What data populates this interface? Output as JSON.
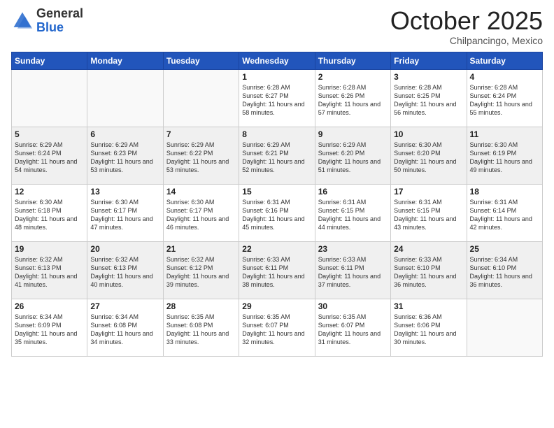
{
  "logo": {
    "general": "General",
    "blue": "Blue"
  },
  "header": {
    "month": "October 2025",
    "location": "Chilpancingo, Mexico"
  },
  "weekdays": [
    "Sunday",
    "Monday",
    "Tuesday",
    "Wednesday",
    "Thursday",
    "Friday",
    "Saturday"
  ],
  "weeks": [
    [
      {
        "day": "",
        "sunrise": "",
        "sunset": "",
        "daylight": ""
      },
      {
        "day": "",
        "sunrise": "",
        "sunset": "",
        "daylight": ""
      },
      {
        "day": "",
        "sunrise": "",
        "sunset": "",
        "daylight": ""
      },
      {
        "day": "1",
        "sunrise": "Sunrise: 6:28 AM",
        "sunset": "Sunset: 6:27 PM",
        "daylight": "Daylight: 11 hours and 58 minutes."
      },
      {
        "day": "2",
        "sunrise": "Sunrise: 6:28 AM",
        "sunset": "Sunset: 6:26 PM",
        "daylight": "Daylight: 11 hours and 57 minutes."
      },
      {
        "day": "3",
        "sunrise": "Sunrise: 6:28 AM",
        "sunset": "Sunset: 6:25 PM",
        "daylight": "Daylight: 11 hours and 56 minutes."
      },
      {
        "day": "4",
        "sunrise": "Sunrise: 6:28 AM",
        "sunset": "Sunset: 6:24 PM",
        "daylight": "Daylight: 11 hours and 55 minutes."
      }
    ],
    [
      {
        "day": "5",
        "sunrise": "Sunrise: 6:29 AM",
        "sunset": "Sunset: 6:24 PM",
        "daylight": "Daylight: 11 hours and 54 minutes."
      },
      {
        "day": "6",
        "sunrise": "Sunrise: 6:29 AM",
        "sunset": "Sunset: 6:23 PM",
        "daylight": "Daylight: 11 hours and 53 minutes."
      },
      {
        "day": "7",
        "sunrise": "Sunrise: 6:29 AM",
        "sunset": "Sunset: 6:22 PM",
        "daylight": "Daylight: 11 hours and 53 minutes."
      },
      {
        "day": "8",
        "sunrise": "Sunrise: 6:29 AM",
        "sunset": "Sunset: 6:21 PM",
        "daylight": "Daylight: 11 hours and 52 minutes."
      },
      {
        "day": "9",
        "sunrise": "Sunrise: 6:29 AM",
        "sunset": "Sunset: 6:20 PM",
        "daylight": "Daylight: 11 hours and 51 minutes."
      },
      {
        "day": "10",
        "sunrise": "Sunrise: 6:30 AM",
        "sunset": "Sunset: 6:20 PM",
        "daylight": "Daylight: 11 hours and 50 minutes."
      },
      {
        "day": "11",
        "sunrise": "Sunrise: 6:30 AM",
        "sunset": "Sunset: 6:19 PM",
        "daylight": "Daylight: 11 hours and 49 minutes."
      }
    ],
    [
      {
        "day": "12",
        "sunrise": "Sunrise: 6:30 AM",
        "sunset": "Sunset: 6:18 PM",
        "daylight": "Daylight: 11 hours and 48 minutes."
      },
      {
        "day": "13",
        "sunrise": "Sunrise: 6:30 AM",
        "sunset": "Sunset: 6:17 PM",
        "daylight": "Daylight: 11 hours and 47 minutes."
      },
      {
        "day": "14",
        "sunrise": "Sunrise: 6:30 AM",
        "sunset": "Sunset: 6:17 PM",
        "daylight": "Daylight: 11 hours and 46 minutes."
      },
      {
        "day": "15",
        "sunrise": "Sunrise: 6:31 AM",
        "sunset": "Sunset: 6:16 PM",
        "daylight": "Daylight: 11 hours and 45 minutes."
      },
      {
        "day": "16",
        "sunrise": "Sunrise: 6:31 AM",
        "sunset": "Sunset: 6:15 PM",
        "daylight": "Daylight: 11 hours and 44 minutes."
      },
      {
        "day": "17",
        "sunrise": "Sunrise: 6:31 AM",
        "sunset": "Sunset: 6:15 PM",
        "daylight": "Daylight: 11 hours and 43 minutes."
      },
      {
        "day": "18",
        "sunrise": "Sunrise: 6:31 AM",
        "sunset": "Sunset: 6:14 PM",
        "daylight": "Daylight: 11 hours and 42 minutes."
      }
    ],
    [
      {
        "day": "19",
        "sunrise": "Sunrise: 6:32 AM",
        "sunset": "Sunset: 6:13 PM",
        "daylight": "Daylight: 11 hours and 41 minutes."
      },
      {
        "day": "20",
        "sunrise": "Sunrise: 6:32 AM",
        "sunset": "Sunset: 6:13 PM",
        "daylight": "Daylight: 11 hours and 40 minutes."
      },
      {
        "day": "21",
        "sunrise": "Sunrise: 6:32 AM",
        "sunset": "Sunset: 6:12 PM",
        "daylight": "Daylight: 11 hours and 39 minutes."
      },
      {
        "day": "22",
        "sunrise": "Sunrise: 6:33 AM",
        "sunset": "Sunset: 6:11 PM",
        "daylight": "Daylight: 11 hours and 38 minutes."
      },
      {
        "day": "23",
        "sunrise": "Sunrise: 6:33 AM",
        "sunset": "Sunset: 6:11 PM",
        "daylight": "Daylight: 11 hours and 37 minutes."
      },
      {
        "day": "24",
        "sunrise": "Sunrise: 6:33 AM",
        "sunset": "Sunset: 6:10 PM",
        "daylight": "Daylight: 11 hours and 36 minutes."
      },
      {
        "day": "25",
        "sunrise": "Sunrise: 6:34 AM",
        "sunset": "Sunset: 6:10 PM",
        "daylight": "Daylight: 11 hours and 36 minutes."
      }
    ],
    [
      {
        "day": "26",
        "sunrise": "Sunrise: 6:34 AM",
        "sunset": "Sunset: 6:09 PM",
        "daylight": "Daylight: 11 hours and 35 minutes."
      },
      {
        "day": "27",
        "sunrise": "Sunrise: 6:34 AM",
        "sunset": "Sunset: 6:08 PM",
        "daylight": "Daylight: 11 hours and 34 minutes."
      },
      {
        "day": "28",
        "sunrise": "Sunrise: 6:35 AM",
        "sunset": "Sunset: 6:08 PM",
        "daylight": "Daylight: 11 hours and 33 minutes."
      },
      {
        "day": "29",
        "sunrise": "Sunrise: 6:35 AM",
        "sunset": "Sunset: 6:07 PM",
        "daylight": "Daylight: 11 hours and 32 minutes."
      },
      {
        "day": "30",
        "sunrise": "Sunrise: 6:35 AM",
        "sunset": "Sunset: 6:07 PM",
        "daylight": "Daylight: 11 hours and 31 minutes."
      },
      {
        "day": "31",
        "sunrise": "Sunrise: 6:36 AM",
        "sunset": "Sunset: 6:06 PM",
        "daylight": "Daylight: 11 hours and 30 minutes."
      },
      {
        "day": "",
        "sunrise": "",
        "sunset": "",
        "daylight": ""
      }
    ]
  ]
}
